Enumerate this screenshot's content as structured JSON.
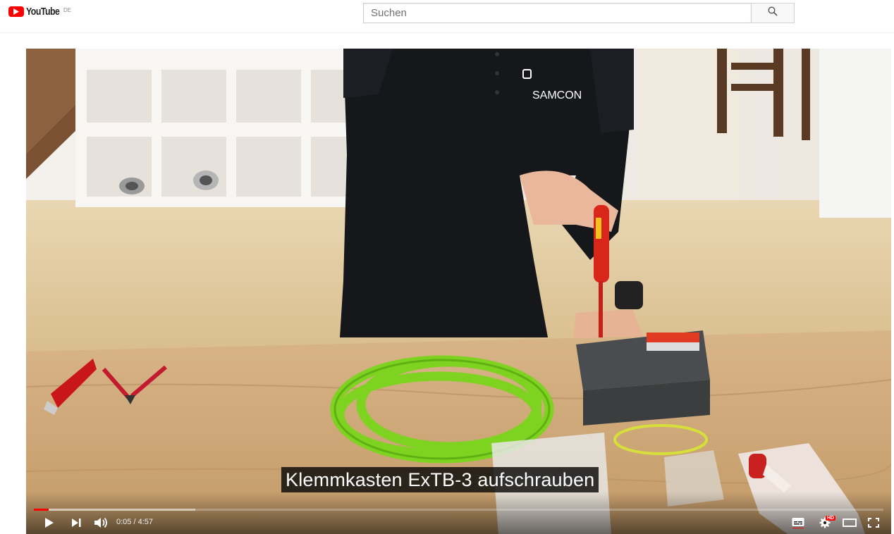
{
  "masthead": {
    "logo_text": "YouTube",
    "country_code": "DE",
    "search": {
      "placeholder": "Suchen",
      "value": "",
      "button_icon": "search-icon"
    }
  },
  "player": {
    "shirt_logo_text": "SAMCON",
    "caption": "Klemmkasten ExTB-3 aufschrauben",
    "time_current": "0:05",
    "time_separator": " / ",
    "time_total": "4:57",
    "progress_played_fraction": 0.0175,
    "progress_buffered_fraction": 0.19,
    "quality_badge": "HD",
    "controls": {
      "play_icon": "play-icon",
      "next_icon": "next-icon",
      "volume_icon": "volume-icon",
      "subtitles_icon": "subtitles-icon",
      "settings_icon": "settings-gear-icon",
      "theater_icon": "theater-mode-icon",
      "fullscreen_icon": "fullscreen-icon"
    },
    "colors": {
      "played": "#ff0000",
      "brand": "#ff0000",
      "cable": "#7ed321"
    }
  }
}
